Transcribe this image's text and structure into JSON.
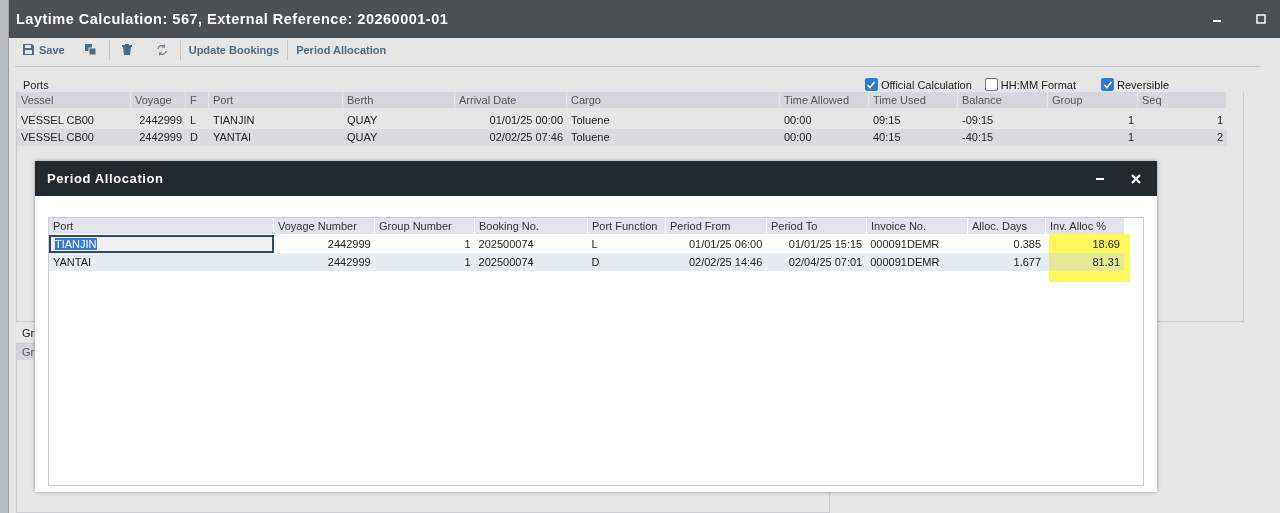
{
  "window": {
    "title": "Laytime Calculation: 567, External Reference: 20260001-01"
  },
  "toolbar": [
    {
      "kind": "save",
      "label": "Save"
    },
    {
      "kind": "copy"
    },
    {
      "kind": "delete"
    },
    {
      "kind": "refresh"
    },
    {
      "kind": "text",
      "label": "Update Bookings"
    },
    {
      "kind": "text",
      "label": "Period Allocation"
    }
  ],
  "ports": {
    "label": "Ports",
    "options": [
      {
        "label": "Official Calculation",
        "checked": true
      },
      {
        "label": "HH:MM Format",
        "checked": false
      },
      {
        "label": "Reversible",
        "checked": true
      }
    ],
    "columns": [
      "Vessel",
      "Voyage",
      "F",
      "Port",
      "Berth",
      "Arrival Date",
      "Cargo",
      "Time Allowed",
      "Time Used",
      "Balance",
      "Group",
      "Seq"
    ],
    "rows": [
      [
        "VESSEL CB00",
        "2442999",
        "L",
        "TIANJIN",
        "QUAY",
        "01/01/25 00:00",
        "Toluene",
        "00:00",
        "09:15",
        "-09:15",
        "1",
        "1"
      ],
      [
        "VESSEL CB00",
        "2442999",
        "D",
        "YANTAI",
        "QUAY",
        "02/02/25 07:46",
        "Toluene",
        "00:00",
        "40:15",
        "-40:15",
        "1",
        "2"
      ]
    ]
  },
  "groups": {
    "label": "Gr",
    "header": "Gr"
  },
  "dialog": {
    "title": "Period Allocation",
    "columns": [
      {
        "label": "Port",
        "highlighted": false
      },
      {
        "label": "Voyage Number",
        "highlighted": false
      },
      {
        "label": "Group Number",
        "highlighted": false
      },
      {
        "label": "Booking No.",
        "highlighted": false
      },
      {
        "label": "Port Function",
        "highlighted": false
      },
      {
        "label": "Period From",
        "highlighted": false
      },
      {
        "label": "Period To",
        "highlighted": false
      },
      {
        "label": "Invoice No.",
        "highlighted": false
      },
      {
        "label": "Alloc. Days",
        "highlighted": false
      },
      {
        "label": "Inv. Alloc %",
        "highlighted": true
      }
    ],
    "rows": [
      {
        "selected": true,
        "cells": [
          "TIANJIN",
          "2442999",
          "1",
          "202500074",
          "L",
          "01/01/25 06:00",
          "01/01/25 15:15",
          "000091DEMR",
          "0.385",
          "18.69"
        ]
      },
      {
        "selected": false,
        "cells": [
          "YANTAI",
          "2442999",
          "1",
          "202500074",
          "D",
          "02/02/25 14:46",
          "02/04/25 07:01",
          "000091DEMR",
          "1.677",
          "81.31"
        ]
      }
    ]
  }
}
